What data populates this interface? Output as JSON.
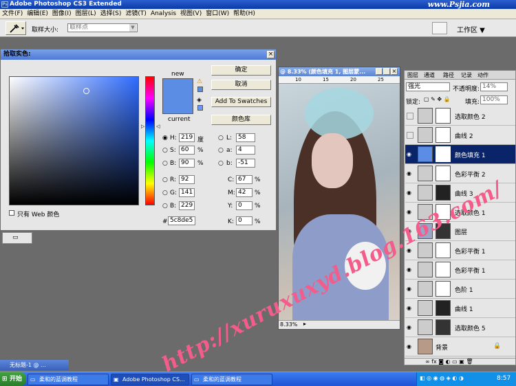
{
  "window": {
    "title": "Adobe Photoshop CS3 Extended",
    "brand": "www.Psjia.com"
  },
  "menu": [
    "文件(F)",
    "编辑(E)",
    "图像(I)",
    "图层(L)",
    "选择(S)",
    "滤镜(T)",
    "Analysis",
    "视图(V)",
    "窗口(W)",
    "帮助(H)"
  ],
  "options": {
    "sample_label": "取样大小:",
    "sample_value": "取样点",
    "workspace": "工作区 ▼"
  },
  "color_picker": {
    "title": "拾取实色:",
    "new_label": "new",
    "current_label": "current",
    "ok": "确定",
    "cancel": "取消",
    "add_swatches": "Add To Swatches",
    "color_library": "颜色库",
    "web_only": "只有 Web 颜色",
    "color_hex": "#5c8de5",
    "fields": {
      "H": {
        "label": "H:",
        "value": "219",
        "unit": "度"
      },
      "S": {
        "label": "S:",
        "value": "60",
        "unit": "%"
      },
      "B": {
        "label": "B:",
        "value": "90",
        "unit": "%"
      },
      "R": {
        "label": "R:",
        "value": "92"
      },
      "G": {
        "label": "G:",
        "value": "141"
      },
      "Bb": {
        "label": "B:",
        "value": "229"
      },
      "L": {
        "label": "L:",
        "value": "58"
      },
      "a": {
        "label": "a:",
        "value": "4"
      },
      "b": {
        "label": "b:",
        "value": "-51"
      },
      "C": {
        "label": "C:",
        "value": "67",
        "unit": "%"
      },
      "M": {
        "label": "M:",
        "value": "42",
        "unit": "%"
      },
      "Y": {
        "label": "Y:",
        "value": "0",
        "unit": "%"
      },
      "K": {
        "label": "K:",
        "value": "0",
        "unit": "%"
      }
    },
    "hex_label": "#",
    "hex_value": "5c8de5"
  },
  "document": {
    "title": "@ 8.33% (颜色填充 1, 图层蒙...",
    "zoom": "8.33%",
    "ruler": [
      "10",
      "15",
      "20",
      "25"
    ]
  },
  "layers_panel": {
    "tabs": [
      "图层",
      "通道",
      "路径",
      "记录",
      "动作"
    ],
    "blend_mode": "强光",
    "opacity_label": "不透明度:",
    "opacity_value": "14%",
    "lock_label": "锁定:",
    "fill_label": "填充:",
    "fill_value": "100%",
    "layers": [
      {
        "name": "选取颜色 2",
        "visible": false
      },
      {
        "name": "曲线 2",
        "visible": false
      },
      {
        "name": "颜色填充 1",
        "visible": true,
        "selected": true
      },
      {
        "name": "色彩平衡 2",
        "visible": true
      },
      {
        "name": "曲线 3",
        "visible": true
      },
      {
        "name": "选取颜色 1",
        "visible": true
      },
      {
        "name": "图层",
        "visible": true
      },
      {
        "name": "色彩平衡 1",
        "visible": true
      },
      {
        "name": "色彩平衡 1",
        "visible": true
      },
      {
        "name": "色阶 1",
        "visible": true
      },
      {
        "name": "曲线 1",
        "visible": true
      },
      {
        "name": "选取颜色 5",
        "visible": true
      },
      {
        "name": "背景",
        "visible": true
      }
    ]
  },
  "minimized_doc": "无标题-1 @ ...",
  "taskbar": {
    "start": "开始",
    "items": [
      "柔和的蓝调教程",
      "Adobe Photoshop CS...",
      "柔和的蓝调教程"
    ],
    "clock": "8:57"
  },
  "watermark": "http://xuruxuxyd.blog.163.com/"
}
